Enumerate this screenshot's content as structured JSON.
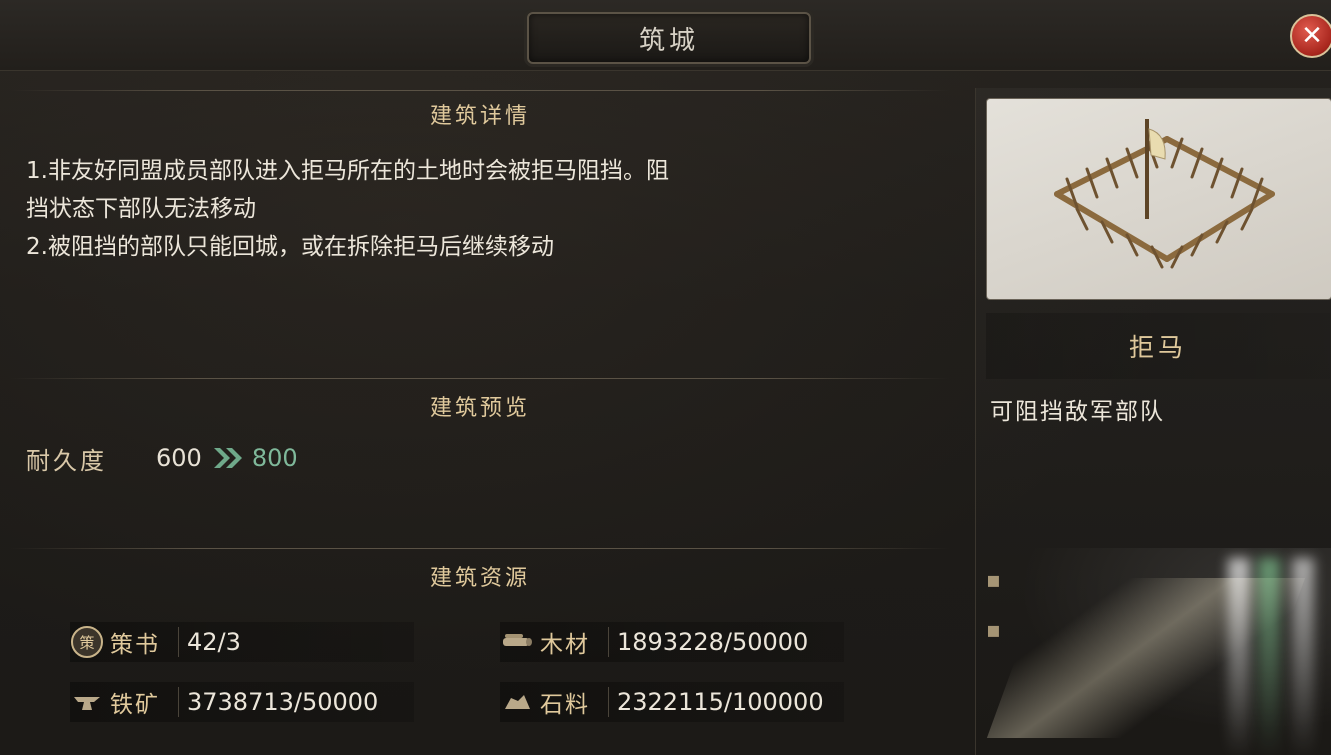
{
  "window": {
    "title": "筑城",
    "close_symbol": "✕"
  },
  "details": {
    "heading": "建筑详情",
    "lines": [
      "1.非友好同盟成员部队进入拒马所在的土地时会被拒马阻挡。阻",
      "挡状态下部队无法移动",
      "2.被阻挡的部队只能回城，或在拆除拒马后继续移动"
    ]
  },
  "preview": {
    "heading": "建筑预览",
    "durability": {
      "label": "耐久度",
      "current": "600",
      "next": "800"
    }
  },
  "resources": {
    "heading": "建筑资源",
    "items": [
      {
        "name": "策书",
        "value": "42/3",
        "icon": "strategy-book-icon",
        "badge": "策"
      },
      {
        "name": "木材",
        "value": "1893228/50000",
        "icon": "wood-icon"
      },
      {
        "name": "铁矿",
        "value": "3738713/50000",
        "icon": "iron-ore-icon"
      },
      {
        "name": "石料",
        "value": "2322115/100000",
        "icon": "stone-icon"
      }
    ]
  },
  "building": {
    "name": "拒马",
    "description": "可阻挡敌军部队",
    "image_icon": "barricade-image"
  },
  "colors": {
    "accent_gold": "#e0c99c",
    "upgrade_green": "#7fb89a",
    "close_red": "#c0392b"
  }
}
